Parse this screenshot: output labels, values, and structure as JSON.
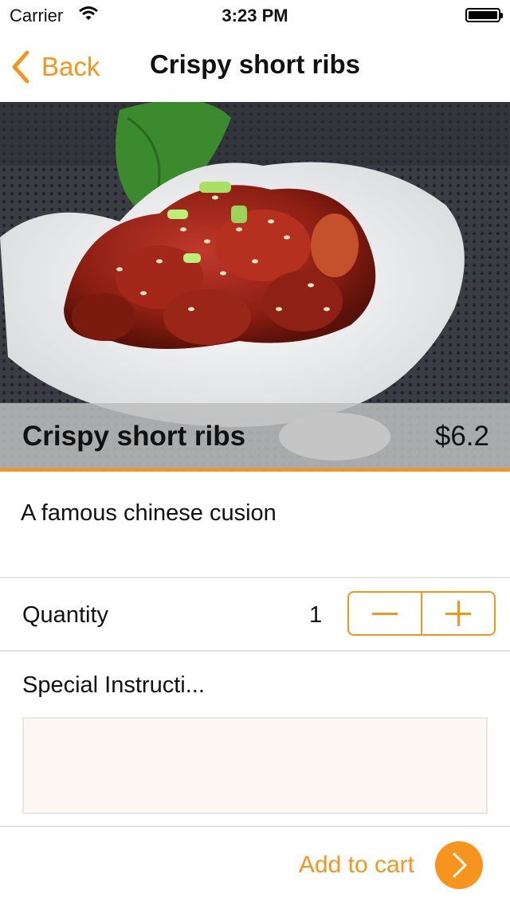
{
  "status_bar": {
    "carrier": "Carrier",
    "time": "3:23 PM"
  },
  "nav": {
    "back_label": "Back",
    "title": "Crispy short ribs"
  },
  "dish": {
    "name": "Crispy short ribs",
    "price": "$6.2",
    "description": "A famous chinese cusion"
  },
  "quantity": {
    "label": "Quantity",
    "value": "1"
  },
  "instructions": {
    "label": "Special Instructi...",
    "value": ""
  },
  "footer": {
    "add_to_cart_label": "Add to cart"
  },
  "colors": {
    "accent": "#f7941d",
    "field_bg": "#fdf9f2",
    "divider": "#e3e3e3"
  },
  "icons": [
    "wifi-icon",
    "battery-icon",
    "back-chevron-icon",
    "minus-icon",
    "plus-icon",
    "chevron-right-icon"
  ]
}
